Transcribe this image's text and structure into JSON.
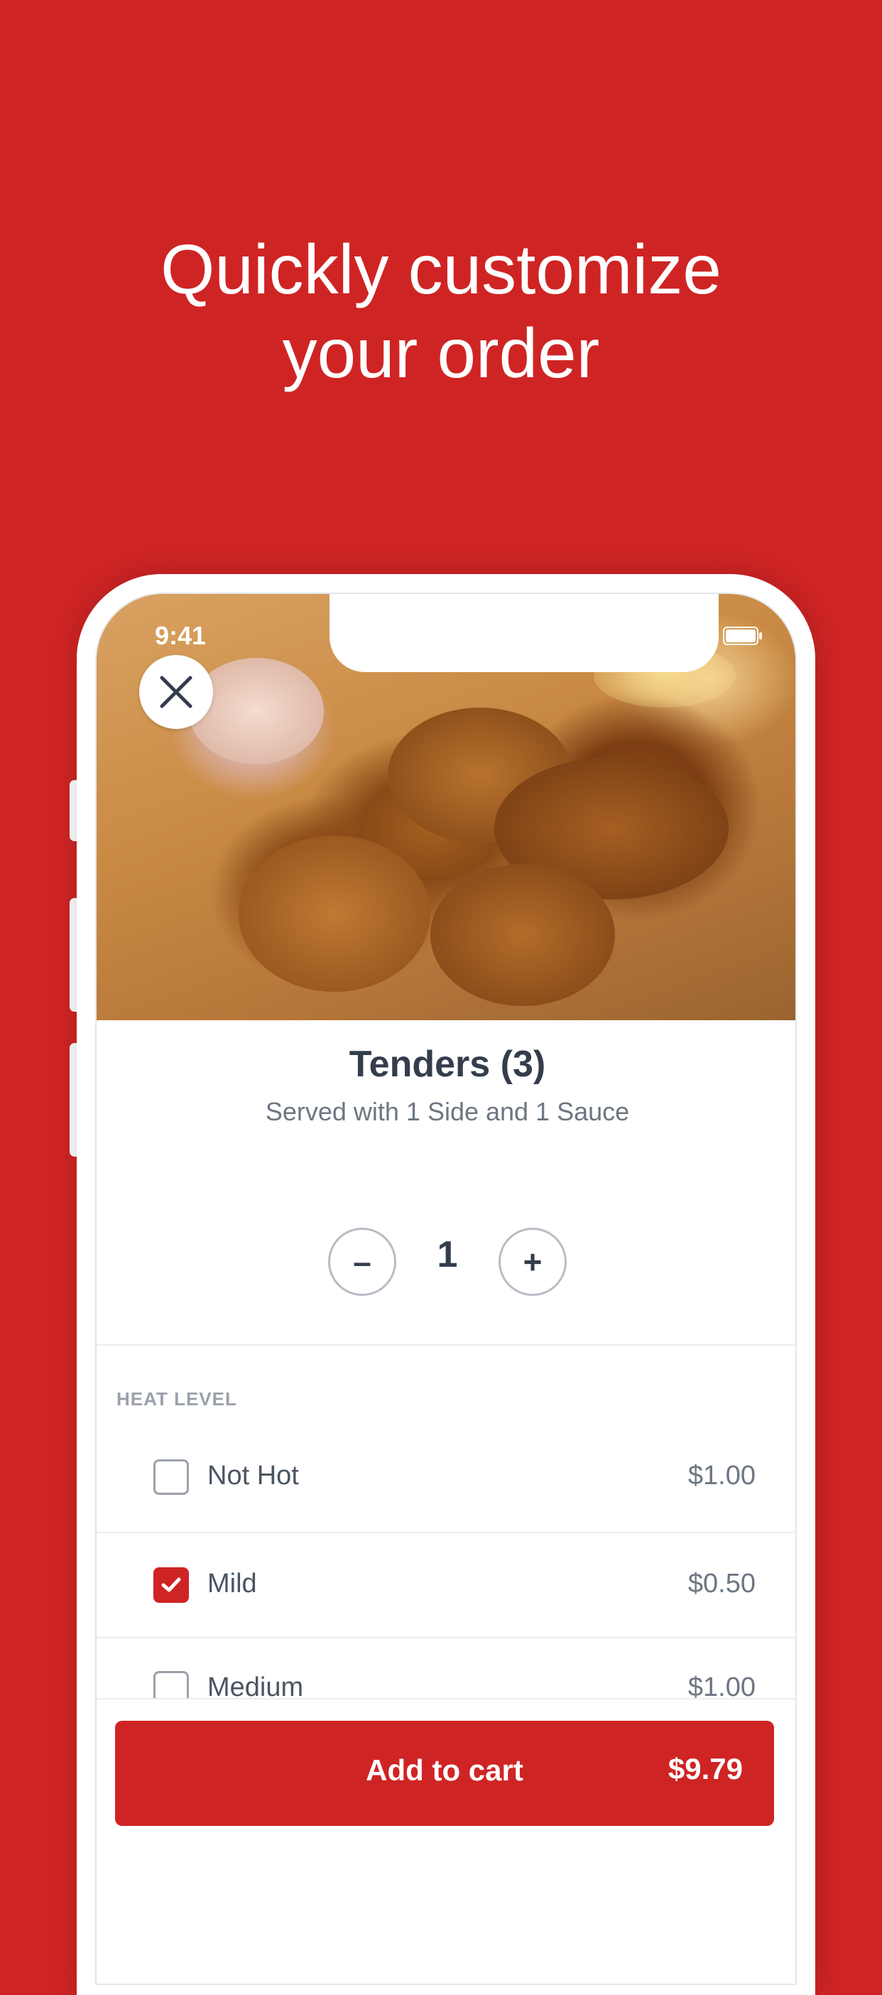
{
  "headline": {
    "line1": "Quickly customize",
    "line2": "your order"
  },
  "status_bar": {
    "time": "9:41"
  },
  "product": {
    "title": "Tenders (3)",
    "subtitle": "Served with 1 Side and 1 Sauce",
    "quantity": "1",
    "decrement_label": "–",
    "increment_label": "+"
  },
  "heat_section": {
    "label": "HEAT LEVEL",
    "options": [
      {
        "label": "Not Hot",
        "price": "$1.00",
        "checked": false
      },
      {
        "label": "Mild",
        "price": "$0.50",
        "checked": true
      },
      {
        "label": "Medium",
        "price": "$1.00",
        "checked": false
      }
    ]
  },
  "cart": {
    "label": "Add to cart",
    "price": "$9.79"
  },
  "colors": {
    "brand_red": "#cf2424",
    "text_dark": "#333d4c",
    "text_muted": "#6d7682"
  },
  "icons": {
    "close": "close-icon",
    "check": "check-icon"
  }
}
